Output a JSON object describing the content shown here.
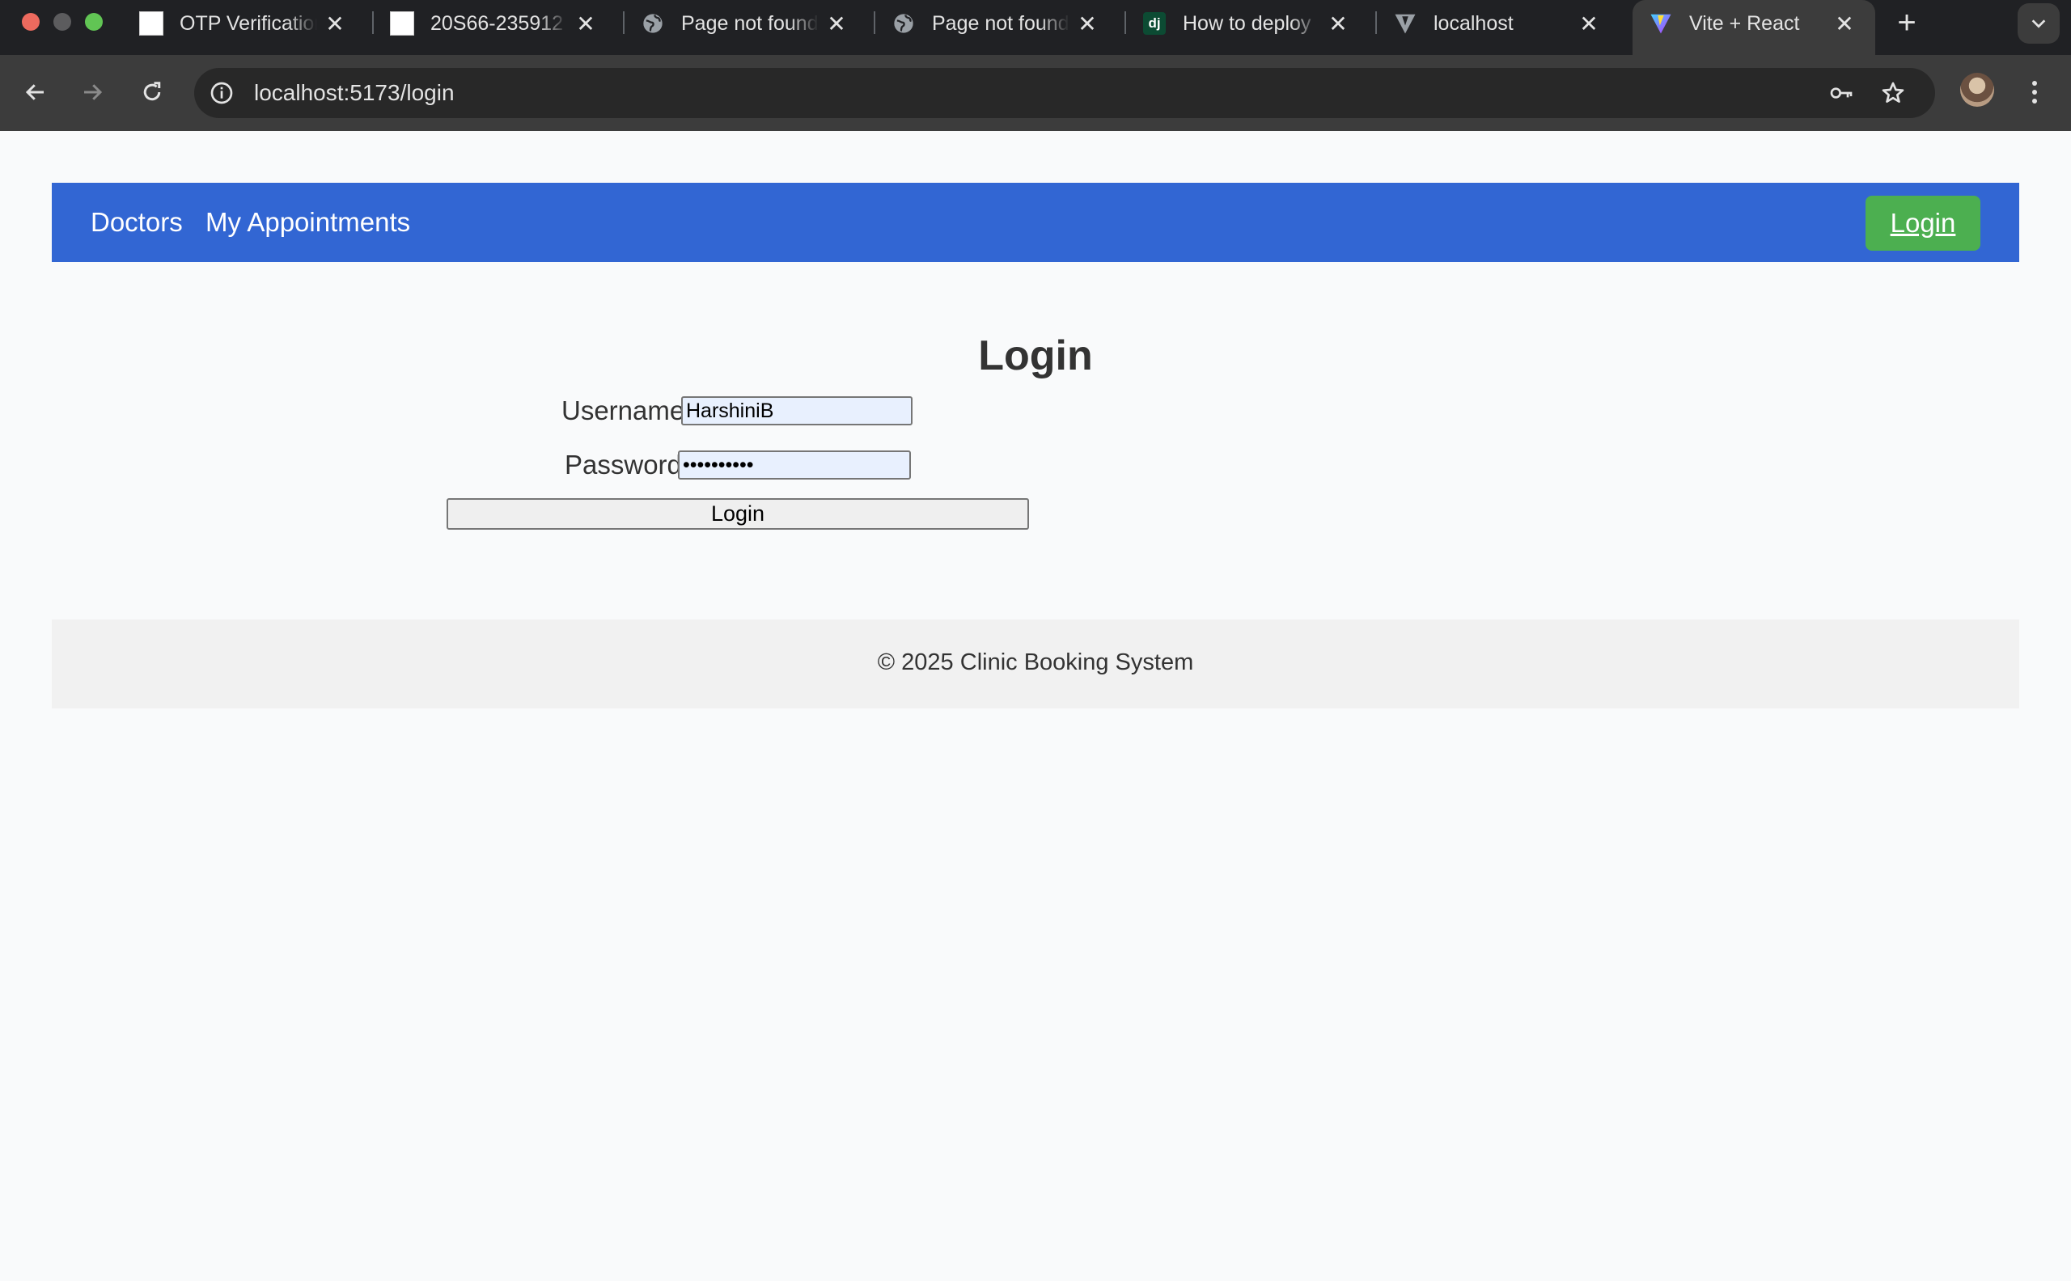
{
  "browser": {
    "tabs": [
      {
        "title": "OTP Verification",
        "favicon": "image-favicon"
      },
      {
        "title": "20S66-235912",
        "favicon": "image-favicon"
      },
      {
        "title": "Page not found",
        "favicon": "globe-icon"
      },
      {
        "title": "Page not found",
        "favicon": "globe-icon"
      },
      {
        "title": "How to deploy",
        "favicon": "django-dj-icon",
        "favicon_text": "dj"
      },
      {
        "title": "localhost",
        "favicon": "vite-icon"
      },
      {
        "title": "Vite + React",
        "favicon": "vite-icon",
        "active": true
      }
    ],
    "address_bar": {
      "url": "localhost:5173/login"
    },
    "colors": {
      "tabstrip": "#202124",
      "toolbar": "#3c3c3c",
      "omnibox": "#282828"
    }
  },
  "page": {
    "navbar": {
      "links": [
        "Doctors",
        "My Appointments"
      ],
      "login_label": "Login",
      "bg_color": "#3266d3",
      "login_color": "#4caf50"
    },
    "title": "Login",
    "form": {
      "username_label": "Username",
      "username_value": "HarshiniB",
      "password_label": "Password",
      "password_value": "••••••••••",
      "submit_label": "Login"
    },
    "footer": {
      "text": "© 2025 Clinic Booking System"
    }
  }
}
